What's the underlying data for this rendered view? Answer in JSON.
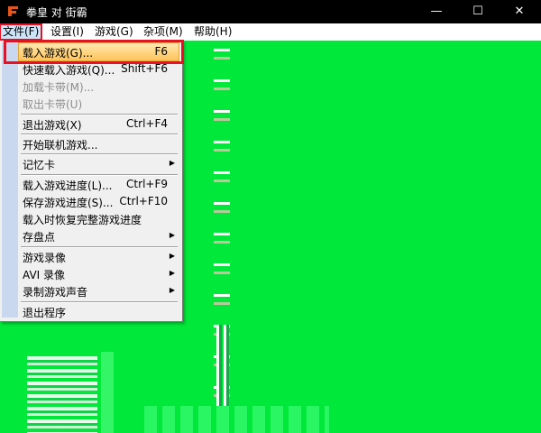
{
  "window": {
    "title": "拳皇 对 街霸",
    "icon": "fighter-logo-icon"
  },
  "window_controls": {
    "minimize": "—",
    "maximize": "☐",
    "close": "✕"
  },
  "menubar": {
    "file": "文件(F)",
    "settings": "设置(I)",
    "games": "游戏(G)",
    "misc": "杂项(M)",
    "help": "帮助(H)"
  },
  "menu": {
    "load_game": {
      "label": "载入游戏(G)...",
      "shortcut": "F6"
    },
    "quick_load": {
      "label": "快速载入游戏(Q)...",
      "shortcut": "Shift+F6"
    },
    "load_cart": {
      "label": "加载卡带(M)..."
    },
    "eject_cart": {
      "label": "取出卡带(U)"
    },
    "exit_game": {
      "label": "退出游戏(X)",
      "shortcut": "Ctrl+F4"
    },
    "netplay": {
      "label": "开始联机游戏..."
    },
    "memory_card": {
      "label": "记忆卡"
    },
    "load_state": {
      "label": "载入游戏进度(L)...",
      "shortcut": "Ctrl+F9"
    },
    "save_state": {
      "label": "保存游戏进度(S)...",
      "shortcut": "Ctrl+F10"
    },
    "restore_on_load": {
      "label": "载入时恢复完整游戏进度"
    },
    "savepoint": {
      "label": "存盘点"
    },
    "record_video": {
      "label": "游戏录像"
    },
    "avi_record": {
      "label": "AVI 录像"
    },
    "record_audio": {
      "label": "录制游戏声音"
    },
    "quit": {
      "label": "退出程序"
    }
  },
  "submenu_arrow": "▶",
  "colors": {
    "background": "#00e83a",
    "highlight_box": "#e81123",
    "menu_bg": "#f0f0f0"
  }
}
